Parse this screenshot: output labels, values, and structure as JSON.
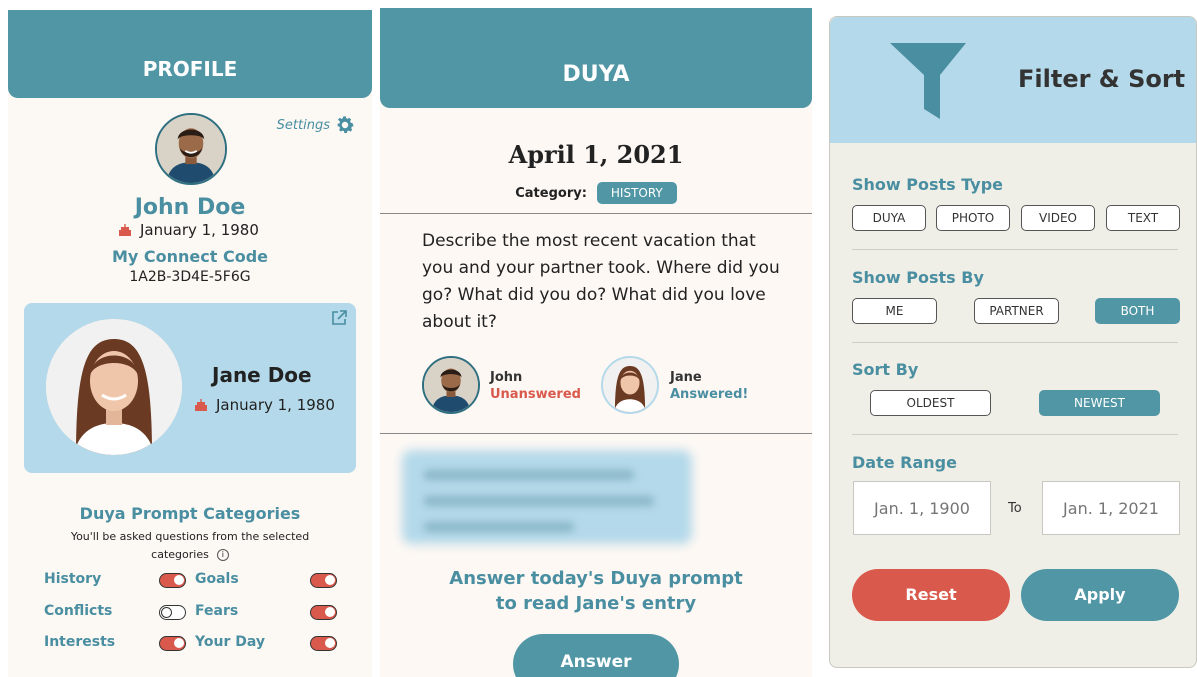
{
  "profile": {
    "header": "PROFILE",
    "settings_label": "Settings",
    "user_name": "John Doe",
    "user_dob": "January 1, 1980",
    "connect_code_label": "My Connect Code",
    "connect_code": "1A2B-3D4E-5F6G",
    "partner_name": "Jane Doe",
    "partner_dob": "January 1, 1980",
    "categories_title": "Duya Prompt Categories",
    "categories_subtitle": "You'll be asked questions from the selected categories",
    "info_icon_glyph": "i",
    "categories": [
      {
        "label": "History",
        "on": true
      },
      {
        "label": "Goals",
        "on": true
      },
      {
        "label": "Conflicts",
        "on": false
      },
      {
        "label": "Fears",
        "on": true
      },
      {
        "label": "Interests",
        "on": true
      },
      {
        "label": "Your Day",
        "on": true
      }
    ]
  },
  "duya": {
    "header": "DUYA",
    "date": "April 1, 2021",
    "category_label": "Category:",
    "category_value": "HISTORY",
    "prompt": "Describe the most recent vacation that you and your partner took. Where did you go? What did you do? What did you love about it?",
    "responses": [
      {
        "name": "John",
        "status": "Unanswered",
        "status_color": "#d9594c"
      },
      {
        "name": "Jane",
        "status": "Answered!",
        "status_color": "#4a8ea1"
      }
    ],
    "cta": "Answer today's Duya prompt to read Jane's entry",
    "answer_button": "Answer"
  },
  "filter": {
    "title": "Filter & Sort",
    "show_type_label": "Show Posts Type",
    "types": [
      "DUYA",
      "PHOTO",
      "VIDEO",
      "TEXT"
    ],
    "show_by_label": "Show Posts By",
    "by_options": [
      "ME",
      "PARTNER",
      "BOTH"
    ],
    "by_selected": "BOTH",
    "sort_label": "Sort By",
    "sort_options": [
      "OLDEST",
      "NEWEST"
    ],
    "sort_selected": "NEWEST",
    "date_range_label": "Date Range",
    "date_from_placeholder": "Jan. 1, 1900",
    "date_to_label": "To",
    "date_to_placeholder": "Jan. 1, 2021",
    "reset_button": "Reset",
    "apply_button": "Apply"
  },
  "colors": {
    "teal": "#5096a5",
    "teal_text": "#4a8ea1",
    "light_blue": "#b4d9ea",
    "red": "#d9594c",
    "cream": "#fcf8f4"
  }
}
